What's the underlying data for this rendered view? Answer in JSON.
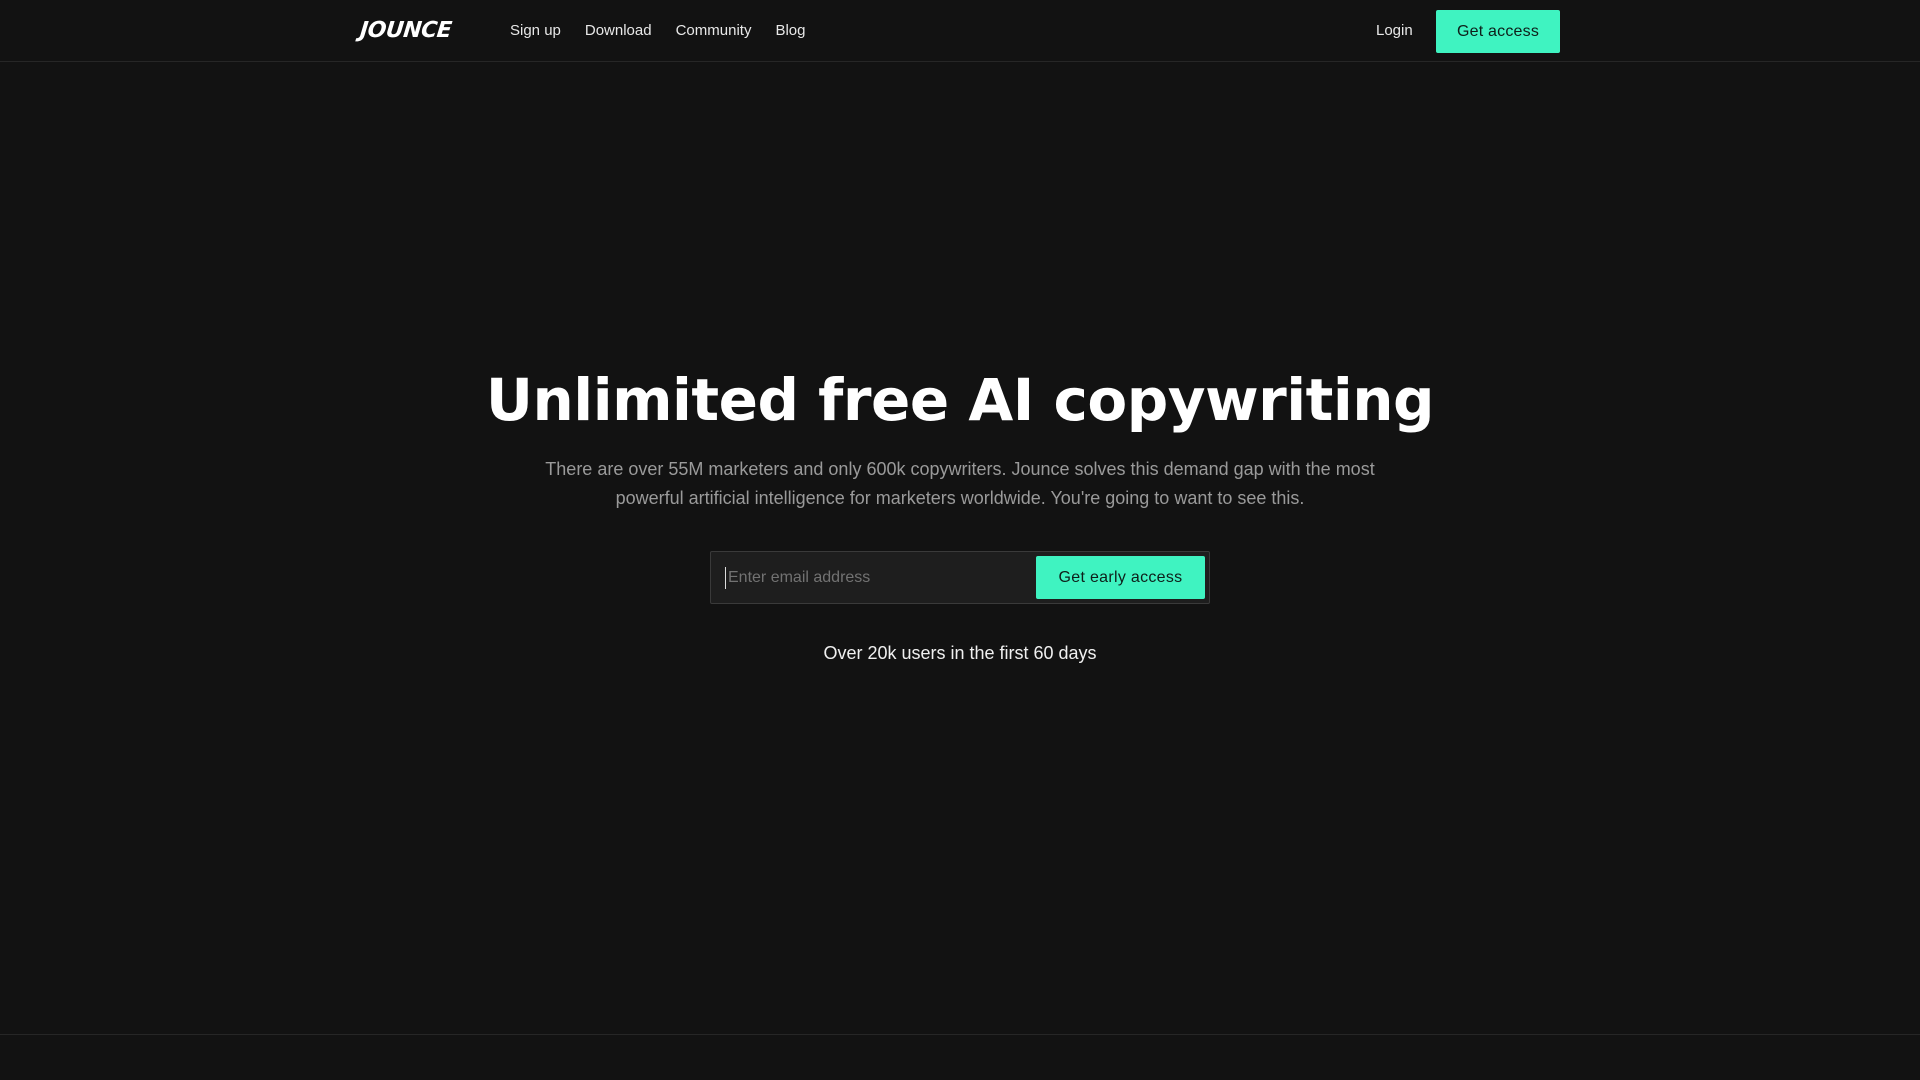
{
  "header": {
    "logo_text": "JOUNCE",
    "nav": [
      {
        "label": "Sign up"
      },
      {
        "label": "Download"
      },
      {
        "label": "Community"
      },
      {
        "label": "Blog"
      }
    ],
    "login_label": "Login",
    "cta_label": "Get access"
  },
  "hero": {
    "title": "Unlimited free AI copywriting",
    "subtitle": "There are over 55M marketers and only 600k copywriters. Jounce solves this demand gap with the most powerful artificial intelligence for marketers worldwide. You're going to want to see this."
  },
  "signup_form": {
    "email_placeholder": "Enter email address",
    "email_value": "",
    "submit_label": "Get early access"
  },
  "social_proof": "Over 20k users in the first 60 days",
  "colors": {
    "background": "#121212",
    "accent": "#3ff3c1",
    "muted_text": "#9a9a9a"
  }
}
